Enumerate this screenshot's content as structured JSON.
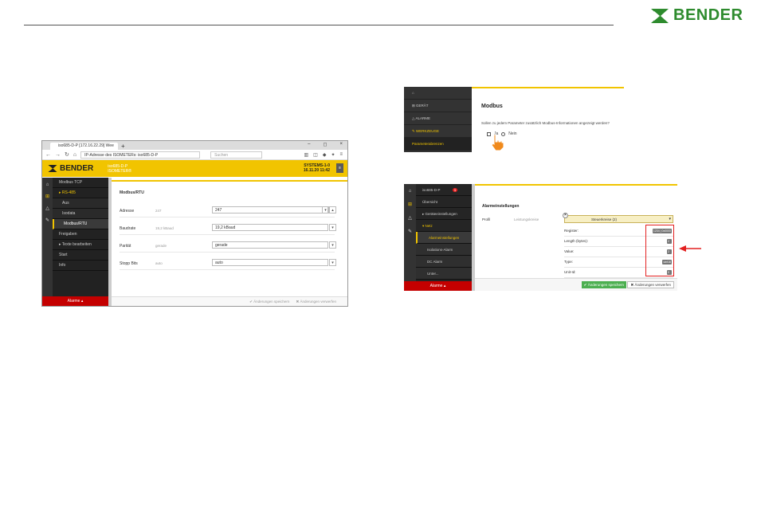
{
  "brand": {
    "name": "BENDER"
  },
  "colors": {
    "accent": "#f1c400",
    "alarm": "#c40000",
    "logo": "#2e8b2e",
    "highlight": "#e32020"
  },
  "screenshot1": {
    "browser": {
      "tab_title": "iso685-D-P [172.16.22.29] Wee",
      "new_tab": "+",
      "url": "IP-Adresse des ISOMETERs: iso685-D-P",
      "search_placeholder": "Suchen",
      "win_min": "–",
      "win_max": "◻",
      "win_close": "×"
    },
    "header": {
      "brand": "BENDER",
      "device_line1": "iso685-D-P",
      "device_line2": "ISOMETER®",
      "system_line1": "SYSTEMS-1-0",
      "system_line2": "16.11.20 11:42",
      "menu_icon": "≡"
    },
    "sidebar": {
      "items": [
        {
          "label": "Modbus TCP"
        },
        {
          "label": "▸ RS-485"
        },
        {
          "label": "Aus"
        },
        {
          "label": "Isodata"
        },
        {
          "label": "Modbus/RTU"
        },
        {
          "label": "Freigaben"
        },
        {
          "label": "▸ Texte bearbeiten"
        },
        {
          "label": "Start"
        },
        {
          "label": "Info"
        }
      ],
      "alarm_label": "Alarme"
    },
    "panel": {
      "title": "Modbus/RTU",
      "rows": [
        {
          "label": "Adresse",
          "current": "247",
          "input": "247"
        },
        {
          "label": "Baudrate",
          "current": "19,2 kBaud",
          "input": "19,2 kBaud"
        },
        {
          "label": "Parität",
          "current": "gerade",
          "input": "gerade"
        },
        {
          "label": "Stopp Bits",
          "current": "auto",
          "input": "auto"
        }
      ],
      "save_label": "Änderungen speichern",
      "discard_label": "Änderungen verwerfen"
    }
  },
  "screenshot2": {
    "sidebar": {
      "items": [
        {
          "label": "GERÄT"
        },
        {
          "label": "ALARME"
        },
        {
          "label": "WERKZEUGE"
        },
        {
          "label": "Parameterabrenzen"
        }
      ]
    },
    "title": "Modbus",
    "question": "Sollen zu jedem Parameter zusätzlich Modbus-Informationen angezeigt werden?",
    "option_yes": "Ja",
    "option_no": "Nein"
  },
  "screenshot3": {
    "sidebar": {
      "device": "iso685-D-P",
      "badge": "1",
      "items": [
        {
          "label": "Übersicht"
        },
        {
          "label": "▸ Geräteeinstellungen"
        },
        {
          "label": "▾ Netz"
        },
        {
          "label": "Alarmeinstellungen"
        },
        {
          "label": "Isolations-Alarm"
        },
        {
          "label": "DC Alarm"
        },
        {
          "label": "Unter..."
        }
      ],
      "alarm_label": "Alarme"
    },
    "section_title": "Alarmeinstellungen",
    "profile_label": "Profil",
    "profile_value": "Leistungskreise",
    "select_value": "Steuerkreise (2)",
    "modbus_rows": [
      {
        "label": "Register:",
        "value": "1234 | 0x0000"
      },
      {
        "label": "Length (bytes):",
        "value": "2"
      },
      {
        "label": "Value:",
        "value": "2"
      },
      {
        "label": "Type:",
        "value": "uint16"
      },
      {
        "label": "Unit-Id:",
        "value": "0"
      }
    ],
    "save_label": "Änderungen speichern",
    "discard_label": "Änderungen verwerfen"
  }
}
